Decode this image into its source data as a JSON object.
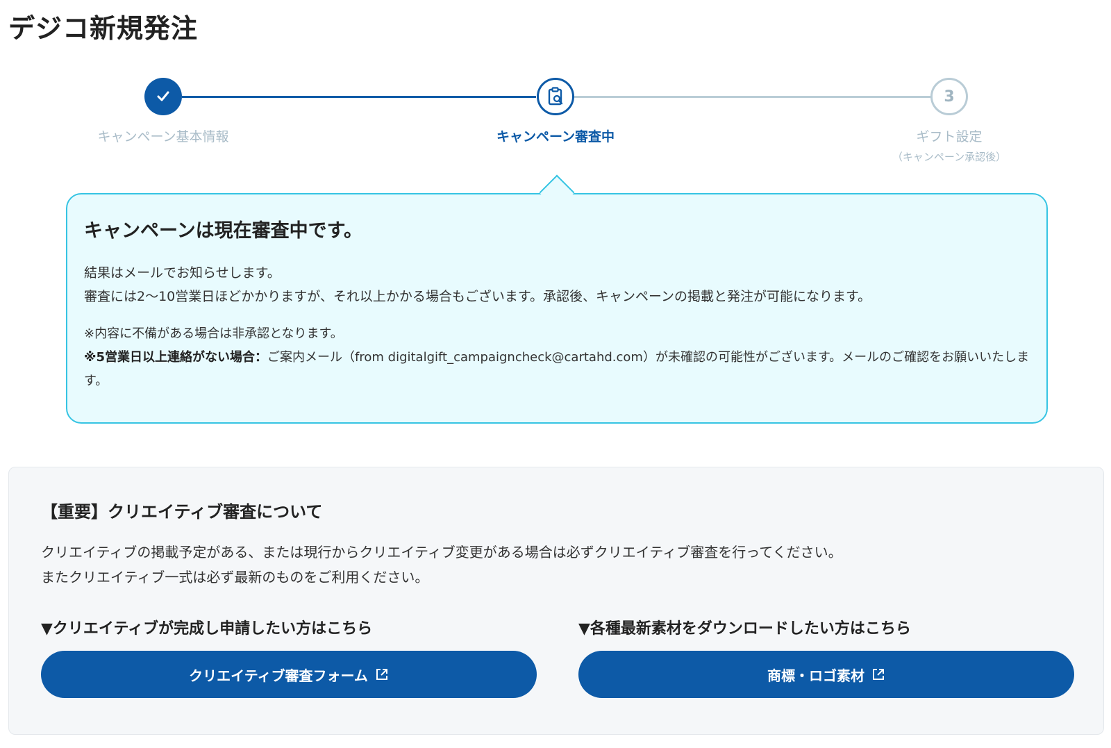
{
  "page": {
    "title": "デジコ新規発注"
  },
  "stepper": {
    "steps": [
      {
        "label": "キャンペーン基本情報",
        "state": "done"
      },
      {
        "label": "キャンペーン審査中",
        "state": "current"
      },
      {
        "label": "ギフト設定",
        "sublabel": "（キャンペーン承認後）",
        "number": "3",
        "state": "upcoming"
      }
    ]
  },
  "review": {
    "title": "キャンペーンは現在審査中です。",
    "body_line1": "結果はメールでお知らせします。",
    "body_line2": "審査には2〜10営業日ほどかかりますが、それ以上かかる場合もございます。承認後、キャンペーンの掲載と発注が可能になります。",
    "note1": "※内容に不備がある場合は非承認となります。",
    "note2_bold": "※5営業日以上連絡がない場合：",
    "note2_text": "ご案内メール（from digitalgift_campaigncheck@cartahd.com）が未確認の可能性がございます。メールのご確認をお願いいたします。"
  },
  "important": {
    "title": "【重要】クリエイティブ審査について",
    "body_line1": "クリエイティブの掲載予定がある、または現行からクリエイティブ変更がある場合は必ずクリエイティブ審査を行ってください。",
    "body_line2": "またクリエイティブ一式は必ず最新のものをご利用ください。",
    "left": {
      "heading": "▼クリエイティブが完成し申請したい方はこちら",
      "button": "クリエイティブ審査フォーム"
    },
    "right": {
      "heading": "▼各種最新素材をダウンロードしたい方はこちら",
      "button": "商標・ロゴ素材"
    }
  },
  "colors": {
    "primary": "#0d5aa7",
    "inactive": "#b9ccd6",
    "review_bg": "#e8fbfe",
    "review_border": "#36c4e3"
  }
}
